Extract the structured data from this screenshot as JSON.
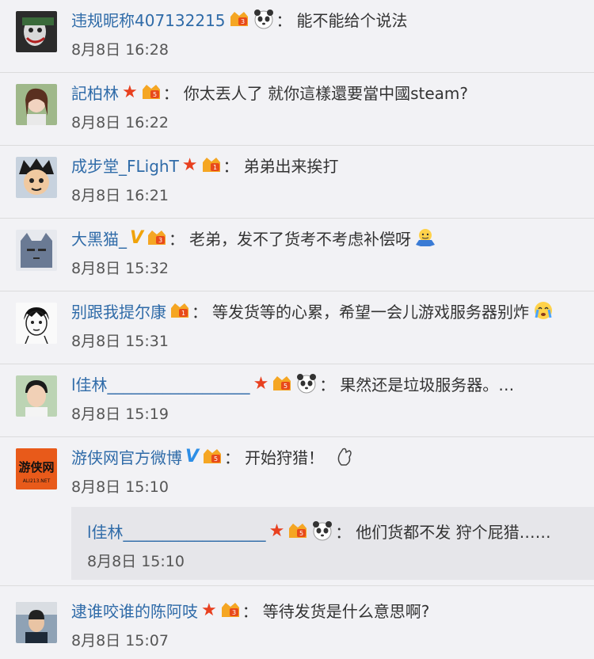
{
  "comments": [
    {
      "name": "违规昵称407132215",
      "text": "能不能给个说法",
      "time": "8月8日 16:28",
      "level": "3"
    },
    {
      "name": "記柏林",
      "text": "你太丟人了 就你這樣還要當中國steam?",
      "time": "8月8日 16:22",
      "level": "5"
    },
    {
      "name": "成步堂_FLighT",
      "text": "弟弟出来挨打",
      "time": "8月8日 16:21",
      "level": "1"
    },
    {
      "name": "大黑猫_",
      "text": "老弟，发不了货考不考虑补偿呀",
      "time": "8月8日 15:32",
      "level": "3"
    },
    {
      "name": "别跟我提尔康",
      "text": "等发货等的心累，希望一会儿游戏服务器别炸",
      "time": "8月8日 15:31",
      "level": "1"
    },
    {
      "name": "l佳林__________________",
      "text": "果然还是垃圾服务器。…",
      "time": "8月8日 15:19",
      "level": "5"
    },
    {
      "name": "游侠网官方微博",
      "text": "开始狩猎！",
      "time": "8月8日 15:10",
      "level": "5",
      "avatar_text": "游侠网",
      "avatar_sub": "ALI213.NET"
    },
    {
      "name": "逮谁咬谁的陈阿吱",
      "text": "等待发货是什么意思啊?",
      "time": "8月8日 15:07",
      "level": "3"
    }
  ],
  "reply": {
    "name": "l佳林__________________",
    "text": "他们货都不发 狩个屁猎……",
    "time": "8月8日 15:10",
    "level": "5"
  },
  "colors": {
    "name": "#2f6ba8",
    "star": "#e8401f",
    "vip_gold": "#f0a30a",
    "vip_blue": "#2d8ee6",
    "background": "#f2f2f5"
  }
}
